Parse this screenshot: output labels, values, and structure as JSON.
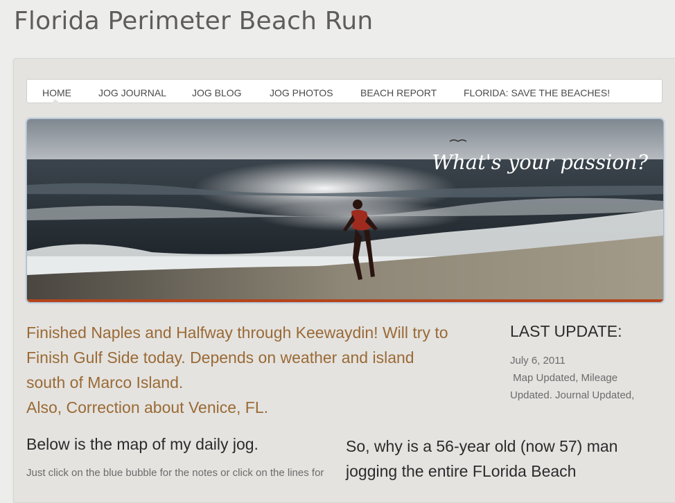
{
  "site": {
    "title": "Florida Perimeter Beach Run"
  },
  "nav": {
    "items": [
      {
        "label": "HOME",
        "active": true
      },
      {
        "label": "JOG JOURNAL"
      },
      {
        "label": "JOG BLOG"
      },
      {
        "label": "JOG PHOTOS"
      },
      {
        "label": "BEACH REPORT"
      },
      {
        "label": "FLORIDA: SAVE THE BEACHES!"
      }
    ]
  },
  "banner": {
    "tagline": "What's your passion?"
  },
  "main": {
    "lead_lines": [
      "Finished Naples and Halfway through Keewaydin!  Will try to",
      "Finish Gulf Side today.  Depends on weather and island",
      "south of Marco Island.",
      "Also, Correction about Venice, FL."
    ],
    "map_heading": "Below is the map of my daily jog.",
    "map_sub": "Just click on the blue bubble for the notes or click on the lines for",
    "why_lines": [
      "So, why is a 56-year old (now 57) man",
      "jogging the entire FLorida Beach"
    ]
  },
  "sidebar": {
    "update_title": "LAST UPDATE:",
    "update_lines": [
      "July 6, 2011",
      " Map Updated, Mileage",
      "Updated. Journal Updated,"
    ]
  },
  "colors": {
    "lead": "#9a6a35",
    "text": "#2b2b2b",
    "muted": "#6b6b6b",
    "title": "#5e5d5b"
  }
}
